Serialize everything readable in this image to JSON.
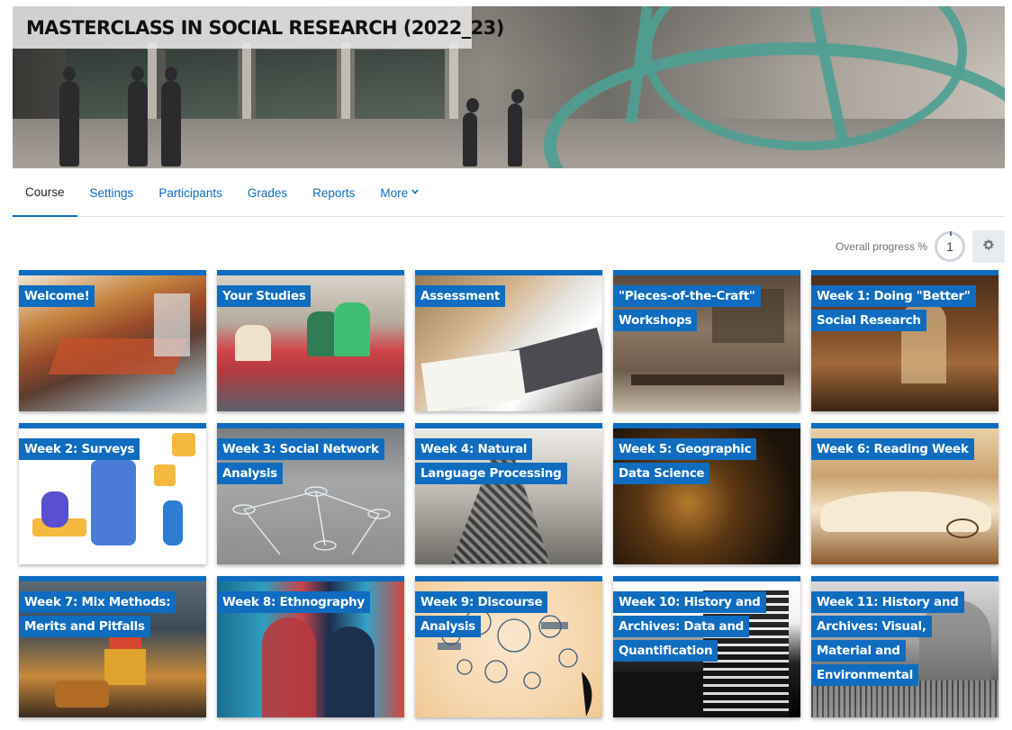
{
  "course": {
    "title": "MASTERCLASS IN SOCIAL RESEARCH (2022_23)"
  },
  "nav": {
    "items": [
      {
        "label": "Course",
        "active": true
      },
      {
        "label": "Settings"
      },
      {
        "label": "Participants"
      },
      {
        "label": "Grades"
      },
      {
        "label": "Reports"
      },
      {
        "label": "More",
        "has_dropdown": true
      }
    ]
  },
  "progress": {
    "label": "Overall progress %",
    "value": "1"
  },
  "tiles": [
    {
      "title": "Welcome!"
    },
    {
      "title": "Your Studies"
    },
    {
      "title": "Assessment"
    },
    {
      "title": "\"Pieces-of-the-Craft\" Workshops"
    },
    {
      "title": "Week 1: Doing \"Better\" Social Research"
    },
    {
      "title": "Week 2: Surveys"
    },
    {
      "title": "Week 3: Social Network Analysis"
    },
    {
      "title": "Week 4: Natural Language Processing"
    },
    {
      "title": "Week 5: Geographic Data Science"
    },
    {
      "title": "Week 6: Reading Week"
    },
    {
      "title": "Week 7: Mix Methods: Merits and Pitfalls"
    },
    {
      "title": "Week 8: Ethnography"
    },
    {
      "title": "Week 9: Discourse Analysis"
    },
    {
      "title": "Week 10: History and Archives: Data and Quantification"
    },
    {
      "title": "Week 11: History and Archives: Visual, Material and Environmental"
    }
  ],
  "colors": {
    "accent": "#0f6cbf",
    "link": "#0f6cbf"
  },
  "icons": {
    "more_dropdown": "chevron-down-icon",
    "settings": "gear-icon"
  }
}
